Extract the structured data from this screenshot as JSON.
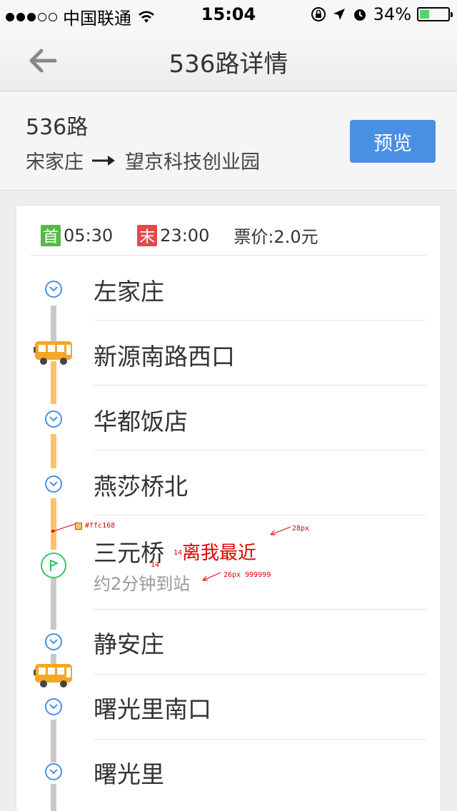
{
  "status_bar": {
    "carrier": "中国联通",
    "time": "15:04",
    "battery": "34%",
    "battery_level": 0.34
  },
  "nav": {
    "title": "536路详情",
    "back_icon": "arrow-left-icon"
  },
  "route": {
    "name": "536路",
    "from": "宋家庄",
    "to": "望京科技创业园",
    "preview_label": "预览",
    "accent_color": "#4a90e2"
  },
  "schedule": {
    "first_tag": "首",
    "first_time": "05:30",
    "last_tag": "末",
    "last_time": "23:00",
    "fare": "票价:2.0元"
  },
  "stations": [
    {
      "name": "左家庄"
    },
    {
      "name": "新源南路西口"
    },
    {
      "name": "华都饭店"
    },
    {
      "name": "燕莎桥北"
    },
    {
      "name": "三元桥",
      "nearest_label": "离我最近",
      "eta": "约2分钟到站"
    },
    {
      "name": "静安庄"
    },
    {
      "name": "曙光里南口"
    },
    {
      "name": "曙光里"
    }
  ],
  "annotations": {
    "color_note": "#ffc168",
    "size_28": "28px",
    "gap_14a": "14",
    "gap_14b": "14",
    "eta_note": "26px  999999"
  },
  "colors": {
    "line_active": "#ffc168",
    "line_inactive": "#c8c8c8",
    "stop_icon": "#4a90e2",
    "nearest_icon": "#3ac46a"
  }
}
